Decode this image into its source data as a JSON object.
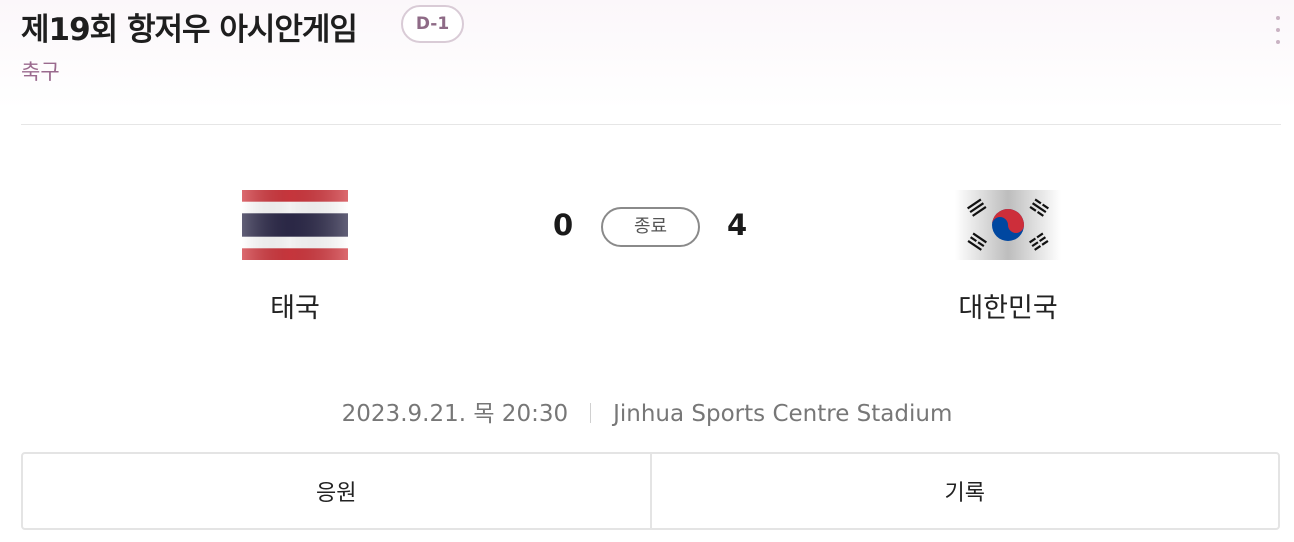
{
  "header": {
    "title": "제19회 항저우 아시안게임",
    "badge": "D-1",
    "subtitle": "축구",
    "more_icon": "more-vertical-icon"
  },
  "match": {
    "home": {
      "name": "태국",
      "score": "0",
      "flag_icon": "thailand-flag-icon"
    },
    "away": {
      "name": "대한민국",
      "score": "4",
      "flag_icon": "south-korea-flag-icon"
    },
    "status": "종료",
    "datetime": "2023.9.21. 목 20:30",
    "venue": "Jinhua Sports Centre Stadium"
  },
  "actions": {
    "cheer_label": "응원",
    "record_label": "기록"
  },
  "colors": {
    "accent": "#9a6a8e",
    "badge_border": "#d9cbd6",
    "thai_red": "#d0383f",
    "thai_blue": "#2d2a4a",
    "korea_red": "#cd2e3a",
    "korea_blue": "#0047a0"
  }
}
